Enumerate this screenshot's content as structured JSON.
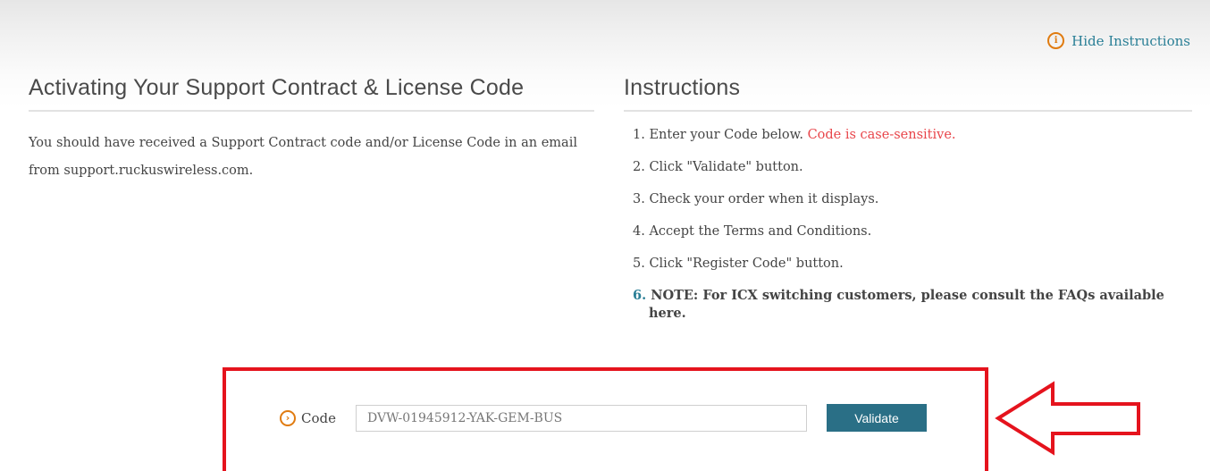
{
  "header": {
    "hide_instructions_label": "Hide Instructions",
    "info_icon": "info-icon"
  },
  "left": {
    "title": "Activating Your Support Contract & License Code",
    "intro": "You should have received a Support Contract code and/or License Code in an email from support.ruckuswireless.com."
  },
  "right": {
    "title": "Instructions",
    "steps": [
      {
        "num": "1.",
        "text": "Enter your Code below. ",
        "warn": "Code is case-sensitive."
      },
      {
        "num": "2.",
        "text": "Click \"Validate\" button."
      },
      {
        "num": "3.",
        "text": "Check your order when it displays."
      },
      {
        "num": "4.",
        "text": "Accept the Terms and Conditions."
      },
      {
        "num": "5.",
        "text": "Click \"Register Code\" button."
      },
      {
        "num": "6.",
        "text": "NOTE: For ICX  switching customers, please consult the FAQs available here."
      }
    ]
  },
  "code_form": {
    "label": "Code",
    "value": "DVW-01945912-YAK-GEM-BUS",
    "validate_label": "Validate",
    "chevron_icon": "chevron-right-icon"
  },
  "colors": {
    "accent_teal": "#2a7f96",
    "button_bg": "#2a6f86",
    "warning_red": "#e8454a",
    "highlight_red": "#e5131d",
    "icon_orange": "#e07b10"
  }
}
